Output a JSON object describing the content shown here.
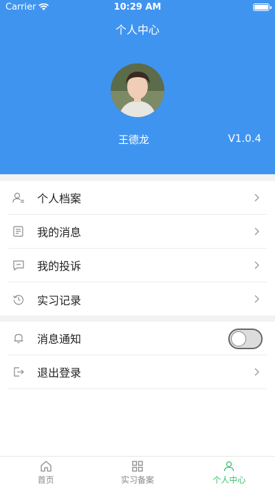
{
  "status_bar": {
    "carrier": "Carrier",
    "time": "10:29 AM"
  },
  "header": {
    "title": "个人中心",
    "name": "王德龙",
    "version": "V1.0.4"
  },
  "menu": {
    "profile": "个人档案",
    "messages": "我的消息",
    "complaints": "我的投诉",
    "internship_records": "实习记录",
    "notifications": "消息通知",
    "logout": "退出登录"
  },
  "notifications_enabled": false,
  "tabs": [
    {
      "label": "首页",
      "icon": "home-icon"
    },
    {
      "label": "实习备案",
      "icon": "grid-icon"
    },
    {
      "label": "个人中心",
      "icon": "person-icon"
    }
  ],
  "colors": {
    "header_bg": "#3f94f0",
    "active_tab": "#3dbf6d"
  }
}
